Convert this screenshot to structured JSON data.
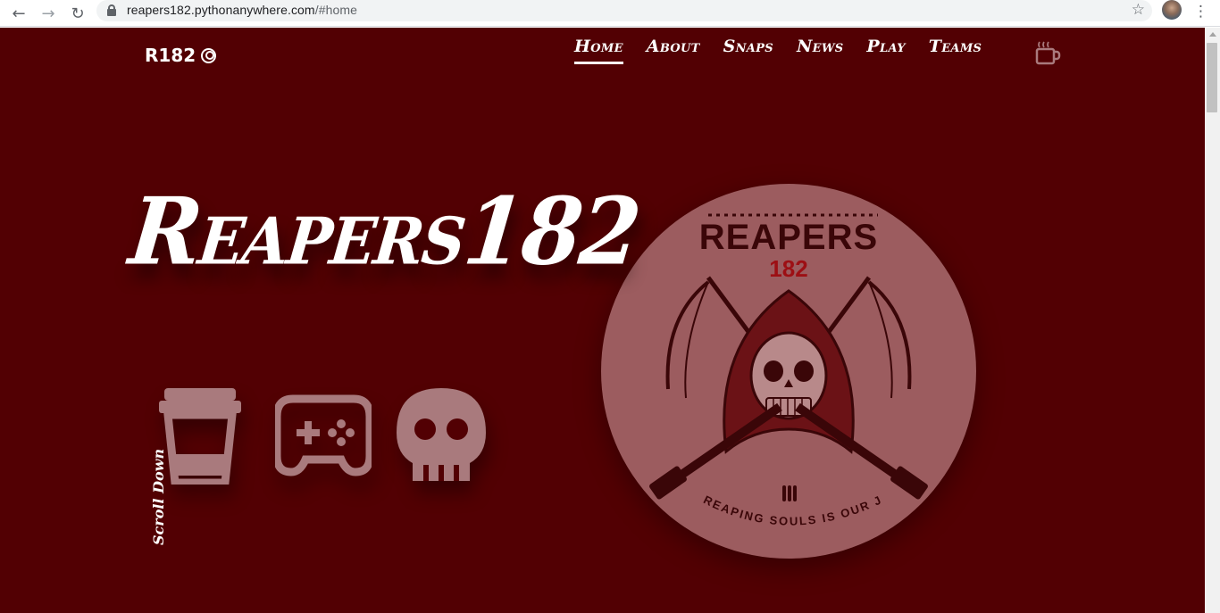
{
  "browser": {
    "url_host": "reapers182.pythonanywhere.com",
    "url_path": "/#home",
    "back_icon": "arrow-left-icon",
    "forward_icon": "arrow-right-icon",
    "reload_icon": "reload-icon",
    "bookmark_icon": "star-icon",
    "menu_icon": "kebab-menu-icon"
  },
  "header": {
    "brand": "R182",
    "brand_icon": "user-circle-icon",
    "nav": [
      {
        "label": "Home",
        "active": true
      },
      {
        "label": "About",
        "active": false
      },
      {
        "label": "Snaps",
        "active": false
      },
      {
        "label": "News",
        "active": false
      },
      {
        "label": "Play",
        "active": false
      },
      {
        "label": "Teams",
        "active": false
      }
    ],
    "cup_icon": "coffee-cup-icon"
  },
  "hero": {
    "title": "Reapers182",
    "icons": [
      "cup-icon",
      "gamepad-icon",
      "skull-icon"
    ],
    "scroll_hint": "Scroll Down"
  },
  "logo": {
    "name": "REAPERS",
    "number": "182",
    "tagline": "REAPING SOULS IS OUR JOB"
  },
  "colors": {
    "page_background": "#520003",
    "logo_circle": "#9c5c5f",
    "text": "#ffffff"
  }
}
